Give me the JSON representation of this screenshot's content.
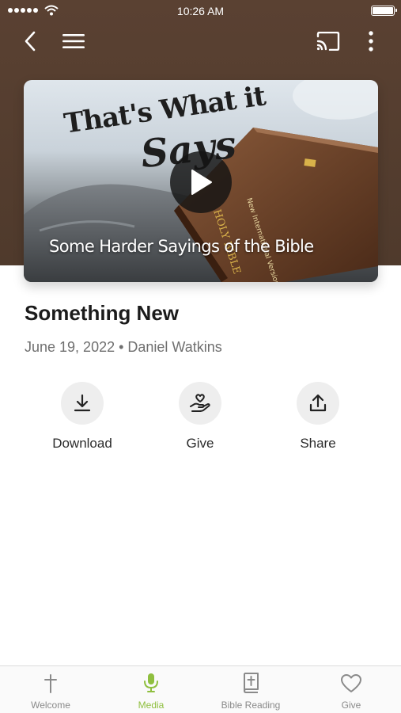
{
  "status_bar": {
    "time": "10:26 AM"
  },
  "thumbnail": {
    "title_line1": "That's What it",
    "title_line2": "Says",
    "subtitle": "Some Harder Sayings of the Bible"
  },
  "sermon": {
    "title": "Something New",
    "meta": "June 19, 2022 • Daniel Watkins"
  },
  "actions": {
    "download_label": "Download",
    "give_label": "Give",
    "share_label": "Share"
  },
  "tabs": [
    {
      "label": "Welcome",
      "icon": "cross-icon",
      "active": false
    },
    {
      "label": "Media",
      "icon": "microphone-icon",
      "active": true
    },
    {
      "label": "Bible Reading",
      "icon": "bible-icon",
      "active": false
    },
    {
      "label": "Give",
      "icon": "heart-icon",
      "active": false
    }
  ],
  "colors": {
    "header": "#5a4132",
    "accent": "#8fbf3f",
    "tab_inactive": "#8a8a8a"
  }
}
